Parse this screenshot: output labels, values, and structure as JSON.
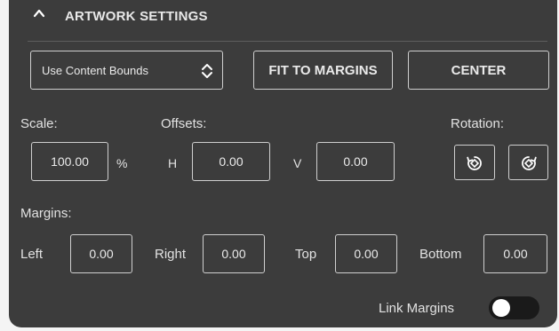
{
  "header": {
    "title": "ARTWORK SETTINGS",
    "collapse_icon": "chevron-up-icon"
  },
  "bounds_select": {
    "value": "Use Content Bounds",
    "icon": "up-down-chevron-icon"
  },
  "buttons": {
    "fit_to_margins": "FIT TO MARGINS",
    "center": "CENTER"
  },
  "scale": {
    "label": "Scale:",
    "value": "100.00",
    "unit": "%"
  },
  "offsets": {
    "label": "Offsets:",
    "h_label": "H",
    "h_value": "0.00",
    "v_label": "V",
    "v_value": "0.00"
  },
  "rotation": {
    "label": "Rotation:",
    "ccw_icon": "rotate-counterclockwise-icon",
    "cw_icon": "rotate-clockwise-icon"
  },
  "margins": {
    "label": "Margins:",
    "left_label": "Left",
    "left_value": "0.00",
    "right_label": "Right",
    "right_value": "0.00",
    "top_label": "Top",
    "top_value": "0.00",
    "bottom_label": "Bottom",
    "bottom_value": "0.00"
  },
  "link_margins": {
    "label": "Link Margins",
    "on": false
  },
  "colors": {
    "panel": "#3c3c3c",
    "text": "#e2e2e2",
    "border": "#cfcfcf",
    "toggle_track": "#1a1a1a"
  }
}
